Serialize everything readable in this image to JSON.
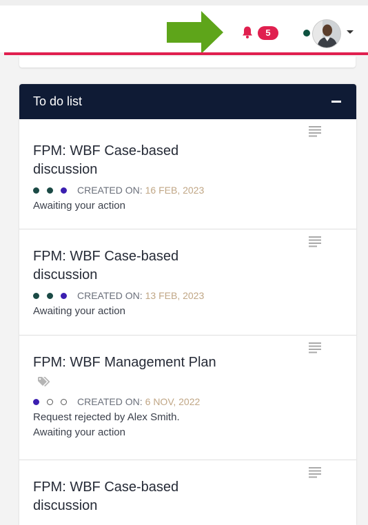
{
  "header": {
    "notification_count": "5",
    "colors": {
      "accent": "#e0204f",
      "arrow": "#5ea51a",
      "online": "#0e5240"
    }
  },
  "todo": {
    "title": "To do list",
    "collapse_label": "–",
    "header_color": "#0f1b35",
    "items": [
      {
        "title": "FPM: WBF Case-based discussion",
        "dots": [
          "filled-green",
          "filled-green",
          "filled-blue"
        ],
        "created_label": "CREATED ON:",
        "created_date": "16 FEB, 2023",
        "status_lines": [
          "Awaiting your action"
        ]
      },
      {
        "title": "FPM: WBF Case-based discussion",
        "dots": [
          "filled-green",
          "filled-green",
          "filled-blue"
        ],
        "created_label": "CREATED ON:",
        "created_date": "13 FEB, 2023",
        "status_lines": [
          "Awaiting your action"
        ]
      },
      {
        "title": "FPM: WBF Management Plan",
        "has_tag_icon": true,
        "dots": [
          "filled-blue",
          "hollow",
          "hollow"
        ],
        "created_label": "CREATED ON:",
        "created_date": "6 NOV, 2022",
        "status_lines": [
          "Request rejected by Alex Smith.",
          "Awaiting your action"
        ]
      },
      {
        "title": "FPM: WBF Case-based discussion"
      }
    ]
  }
}
